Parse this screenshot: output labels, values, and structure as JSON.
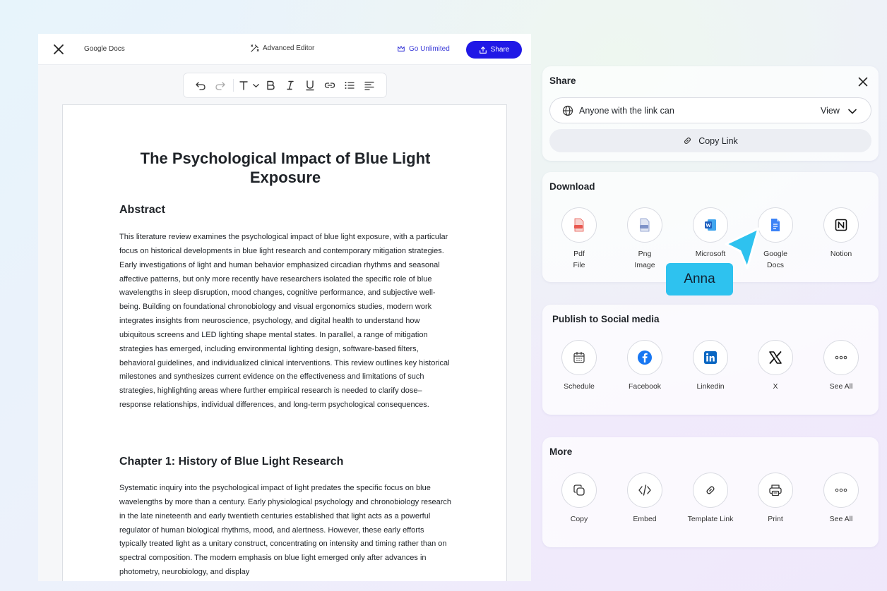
{
  "editor": {
    "app_name": "Google Docs",
    "advanced_editor_label": "Advanced Editor",
    "go_unlimited_label": "Go Unlimited",
    "share_label": "Share",
    "toolbar_icons": [
      "undo-icon",
      "redo-icon",
      "text-type-icon",
      "chevron-down-icon",
      "bold-icon",
      "italic-icon",
      "underline-icon",
      "link-icon",
      "bullet-list-icon",
      "align-left-icon"
    ]
  },
  "document": {
    "title": "The Psychological Impact of Blue Light Exposure",
    "abstract_heading": "Abstract",
    "abstract_text": "This literature review examines the psychological impact of blue light exposure, with a particular focus on historical developments in blue light research and contemporary mitigation strategies. Early investigations of light and human behavior emphasized circadian rhythms and seasonal affective patterns, but only more recently have researchers isolated the specific role of blue wavelengths in sleep disruption, mood changes, cognitive performance, and subjective well-being. Building on foundational chronobiology and visual ergonomics studies, modern work integrates insights from neuroscience, psychology, and digital health to understand how ubiquitous screens and LED lighting shape mental states. In parallel, a range of mitigation strategies has emerged, including environmental lighting design, software-based filters, behavioral guidelines, and individualized clinical interventions. This review outlines key historical milestones and synthesizes current evidence on the effectiveness and limitations of such strategies, highlighting areas where further empirical research is needed to clarify dose–response relationships, individual differences, and long-term psychological consequences.",
    "chapter1_heading": "Chapter 1: History of Blue Light Research",
    "chapter1_text": "Systematic inquiry into the psychological impact of light predates the specific focus on blue wavelengths by more than a century. Early physiological psychology and chronobiology research in the late nineteenth and early twentieth centuries established that light acts as a powerful regulator of human biological rhythms, mood, and alertness. However, these early efforts typically treated light as a unitary construct, concentrating on intensity and timing rather than on spectral composition. The modern emphasis on blue light emerged only after advances in photometry, neurobiology, and display"
  },
  "share_panel": {
    "title": "Share",
    "permission_text": "Anyone with the link can",
    "permission_value": "View",
    "copy_link_label": "Copy Link"
  },
  "download": {
    "title": "Download",
    "items": [
      {
        "label": "Pdf\nFile",
        "icon": "pdf-file-icon",
        "color": "#e8584f"
      },
      {
        "label": "Png\nImage",
        "icon": "png-image-icon",
        "color": "#7f93c8"
      },
      {
        "label": "Microsoft",
        "icon": "microsoft-word-icon",
        "color": "#1e5fbf"
      },
      {
        "label": "Google\nDocs",
        "icon": "google-docs-icon",
        "color": "#3b82f6"
      },
      {
        "label": "Notion",
        "icon": "notion-icon",
        "color": "#111111"
      }
    ]
  },
  "social": {
    "title": "Publish to Social media",
    "items": [
      {
        "label": "Schedule",
        "icon": "calendar-icon"
      },
      {
        "label": "Facebook",
        "icon": "facebook-icon",
        "color": "#1877f2"
      },
      {
        "label": "Linkedin",
        "icon": "linkedin-icon",
        "color": "#0a66c2"
      },
      {
        "label": "X",
        "icon": "x-icon"
      },
      {
        "label": "See All",
        "icon": "more-dots-icon"
      }
    ]
  },
  "more": {
    "title": "More",
    "items": [
      {
        "label": "Copy",
        "icon": "copy-icon"
      },
      {
        "label": "Embed",
        "icon": "code-icon"
      },
      {
        "label": "Template Link",
        "icon": "link-icon"
      },
      {
        "label": "Print",
        "icon": "printer-icon"
      },
      {
        "label": "See All",
        "icon": "more-dots-icon"
      }
    ]
  },
  "cursor": {
    "user_name": "Anna",
    "color": "#2ec2ef"
  },
  "colors": {
    "accent": "#2018e6",
    "go_unlimited": "#3b3bd8"
  }
}
